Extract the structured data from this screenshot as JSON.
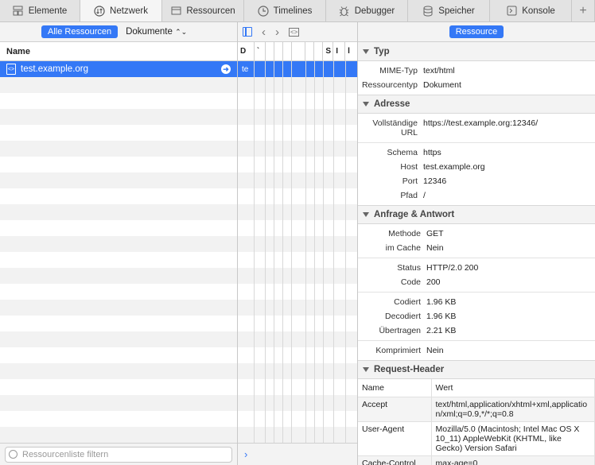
{
  "tabs": [
    {
      "label": "Elemente",
      "icon": "elements-icon"
    },
    {
      "label": "Netzwerk",
      "icon": "network-icon"
    },
    {
      "label": "Ressourcen",
      "icon": "resources-icon"
    },
    {
      "label": "Timelines",
      "icon": "timelines-icon"
    },
    {
      "label": "Debugger",
      "icon": "debugger-icon"
    },
    {
      "label": "Speicher",
      "icon": "storage-icon"
    },
    {
      "label": "Konsole",
      "icon": "console-icon"
    }
  ],
  "active_tab": "Netzwerk",
  "left": {
    "filter_all": "Alle Ressourcen",
    "type_filter": "Dokumente",
    "column_name": "Name",
    "selected_resource": "test.example.org",
    "filter_placeholder": "Ressourcenliste filtern"
  },
  "mid": {
    "columns": [
      "D",
      "`",
      "",
      "",
      "",
      "",
      "",
      "",
      "S",
      "I",
      "l"
    ],
    "selected_row_text": "te"
  },
  "right": {
    "mode_button": "Ressource",
    "sections": {
      "typ": {
        "title": "Typ",
        "mime_label": "MIME-Typ",
        "mime_value": "text/html",
        "restype_label": "Ressourcentyp",
        "restype_value": "Dokument"
      },
      "adresse": {
        "title": "Adresse",
        "full_url_label_1": "Vollständige",
        "full_url_label_2": "URL",
        "full_url_value": "https://test.example.org:12346/",
        "scheme_label": "Schema",
        "scheme_value": "https",
        "host_label": "Host",
        "host_value": "test.example.org",
        "port_label": "Port",
        "port_value": "12346",
        "path_label": "Pfad",
        "path_value": "/"
      },
      "anfrage": {
        "title": "Anfrage & Antwort",
        "method_label": "Methode",
        "method_value": "GET",
        "cache_label": "im Cache",
        "cache_value": "Nein",
        "status_label": "Status",
        "status_value": "HTTP/2.0 200",
        "code_label": "Code",
        "code_value": "200",
        "encoded_label": "Codiert",
        "encoded_value": "1.96 KB",
        "decoded_label": "Decodiert",
        "decoded_value": "1.96 KB",
        "transferred_label": "Übertragen",
        "transferred_value": "2.21 KB",
        "compressed_label": "Komprimiert",
        "compressed_value": "Nein"
      },
      "request_header": {
        "title": "Request-Header",
        "col_name": "Name",
        "col_value": "Wert",
        "rows": [
          {
            "name": "Accept",
            "value": "text/html,application/xhtml+xml,application/xml;q=0.9,*/*;q=0.8"
          },
          {
            "name": "User-Agent",
            "value": "Mozilla/5.0 (Macintosh; Intel Mac OS X 10_11) AppleWebKit (KHTML, like Gecko) Version Safari"
          },
          {
            "name": "Cache-Control",
            "value": "max-age=0"
          }
        ]
      }
    }
  }
}
